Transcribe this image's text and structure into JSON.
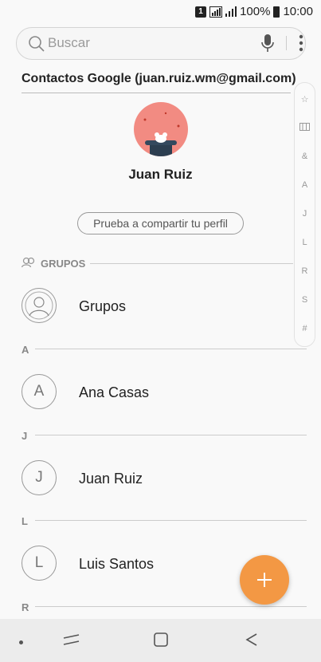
{
  "status_bar": {
    "sim_label": "1",
    "battery_pct": "100%",
    "time": "10:00"
  },
  "search": {
    "placeholder": "Buscar"
  },
  "account": {
    "label": "Contactos Google (juan.ruiz.wm@gmail.com)"
  },
  "profile": {
    "name": "Juan Ruiz",
    "share_button": "Prueba a compartir tu perfil"
  },
  "groups_section": {
    "header": "GRUPOS",
    "item": "Grupos"
  },
  "contacts": [
    {
      "section": "A",
      "initial": "A",
      "name": "Ana Casas"
    },
    {
      "section": "J",
      "initial": "J",
      "name": "Juan Ruiz"
    },
    {
      "section": "L",
      "initial": "L",
      "name": "Luis Santos"
    },
    {
      "section": "R"
    }
  ],
  "index_bar": [
    "☆",
    "&",
    "A",
    "J",
    "L",
    "R",
    "S",
    "#"
  ],
  "colors": {
    "fab": "#f39844",
    "avatar_bg": "#f28b82"
  }
}
